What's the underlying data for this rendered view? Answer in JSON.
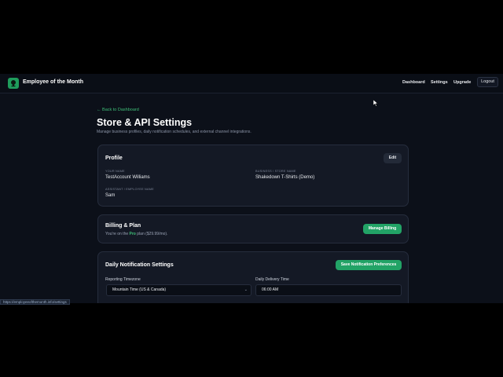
{
  "navbar": {
    "brand": "Employee of the Month",
    "links": [
      "Dashboard",
      "Settings",
      "Upgrade"
    ],
    "logout": "Logout"
  },
  "page": {
    "back_link": "← Back to Dashboard",
    "title": "Store & API Settings",
    "subtitle": "Manage business profiles, daily notification schedules, and external channel integrations."
  },
  "profile": {
    "title": "Profile",
    "edit_label": "Edit",
    "your_name_label": "YOUR NAME",
    "your_name": "TestAccount Williams",
    "store_label": "BUSINESS / STORE NAME",
    "store_name": "Shakedown T-Shirts (Demo)",
    "assistant_label": "ASSISTANT / EMPLOYEE NAME",
    "assistant_name": "Sam"
  },
  "billing": {
    "title": "Billing & Plan",
    "text_prefix": "You're on the",
    "plan": "Pro",
    "text_suffix": "plan ($29.99/mo).",
    "manage_label": "Manage Billing"
  },
  "notifications": {
    "title": "Daily Notification Settings",
    "save_label": "Save Notification Preferences",
    "timezone_label": "Reporting Timezone",
    "timezone_value": "Mountain Time (US & Canada)",
    "delivery_label": "Daily Delivery Time",
    "delivery_value": "06:00 AM"
  },
  "status_url": "https://employeeofthemonth.info/settings",
  "colors": {
    "accent": "#22a366",
    "background": "#0c1019",
    "card": "#141925"
  },
  "icons": {
    "logo": "trophy-logo-icon",
    "select": "chevron-down-icon",
    "cursor": "mouse-cursor-icon"
  }
}
